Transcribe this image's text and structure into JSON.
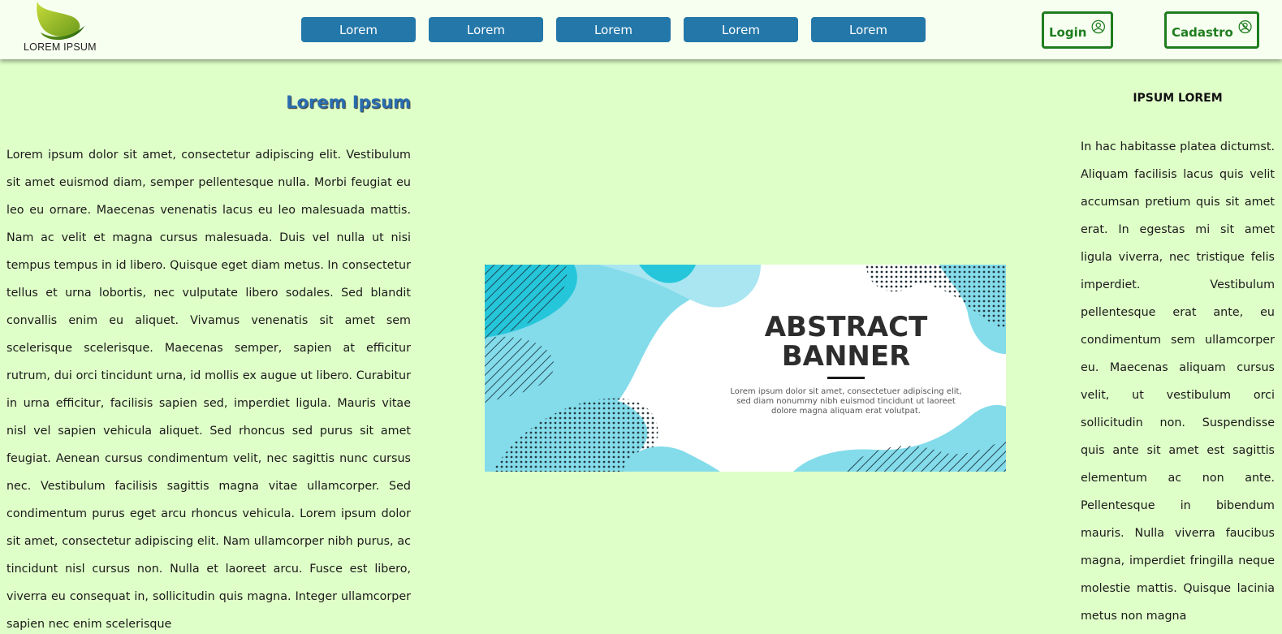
{
  "header": {
    "logo_text": "LOREM IPSUM",
    "nav": [
      "Lorem",
      "Lorem",
      "Lorem",
      "Lorem",
      "Lorem"
    ],
    "login_label": "Login",
    "cadastro_label": "Cadastro"
  },
  "left": {
    "title": "Lorem Ipsum",
    "text": "Lorem ipsum dolor sit amet, consectetur adipiscing elit. Vestibulum sit amet euismod diam, semper pellentesque nulla. Morbi feugiat eu leo eu ornare. Maecenas venenatis lacus eu leo malesuada mattis. Nam ac velit et magna cursus malesuada. Duis vel nulla ut nisi tempus tempus in id libero. Quisque eget diam metus. In consectetur tellus et urna lobortis, nec vulputate libero sodales. Sed blandit convallis enim eu aliquet. Vivamus venenatis sit amet sem scelerisque scelerisque. Maecenas semper, sapien at efficitur rutrum, dui orci tincidunt urna, id mollis ex augue ut libero. Curabitur in urna efficitur, facilisis sapien sed, imperdiet ligula. Mauris vitae nisl vel sapien vehicula aliquet. Sed rhoncus sed purus sit amet feugiat. Aenean cursus condimentum velit, nec sagittis nunc cursus nec. Vestibulum facilisis sagittis magna vitae ullamcorper. Sed condimentum purus eget arcu rhoncus vehicula. Lorem ipsum dolor sit amet, consectetur adipiscing elit. Nam ullamcorper nibh purus, ac tincidunt nisl cursus non. Nulla et laoreet arcu. Fusce est libero, viverra eu consequat in, sollicitudin quis magna. Integer ullamcorper sapien nec enim scelerisque"
  },
  "banner": {
    "title_line1": "ABSTRACT",
    "title_line2": "BANNER",
    "caption_line1": "Lorem ipsum dolor sit amet, consectetuer adipiscing elit,",
    "caption_line2": "sed diam nonummy nibh euismod tincidunt ut laoreet",
    "caption_line3": "dolore magna aliquam erat volutpat."
  },
  "right": {
    "title": "IPSUM LOREM",
    "text": "In hac habitasse platea dictumst. Aliquam facilisis lacus quis velit accumsan pretium quis sit amet erat. In egestas mi sit amet ligula viverra, nec tristique felis imperdiet. Vestibulum pellentesque erat ante, eu condimentum sem ullamcorper eu. Maecenas aliquam cursus velit, ut vestibulum orci sollicitudin non. Suspendisse quis ante sit amet est sagittis elementum ac non ante. Pellentesque in bibendum mauris. Nulla viverra faucibus magna, imperdiet fringilla neque molestie mattis. Quisque lacinia metus non magna"
  },
  "colors": {
    "background": "#dfffc8",
    "header_bg": "#f7fff0",
    "nav_button": "#2377a9",
    "auth_green": "#1f7d1f",
    "title_blue": "#2a6db0",
    "banner_cyan": "#84dcea"
  },
  "icons": {
    "login": "user-circle-icon",
    "cadastro": "user-slash-icon"
  }
}
